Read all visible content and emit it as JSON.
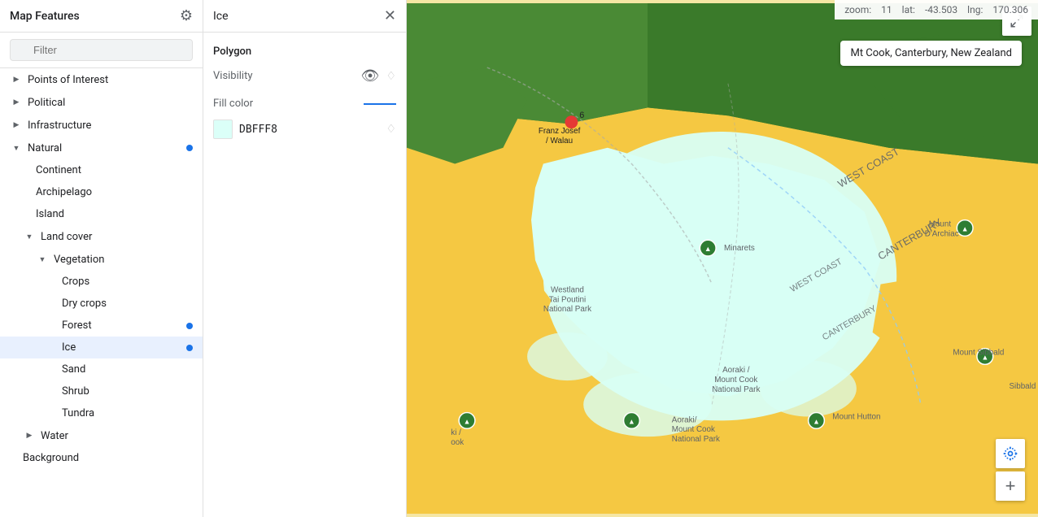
{
  "sidebar": {
    "title": "Map Features",
    "filter_placeholder": "Filter",
    "items": [
      {
        "id": "points-of-interest",
        "label": "Points of Interest",
        "indent": 0,
        "hasChevron": true,
        "chevronDir": "right",
        "dot": false,
        "active": false
      },
      {
        "id": "political",
        "label": "Political",
        "indent": 0,
        "hasChevron": true,
        "chevronDir": "right",
        "dot": false,
        "active": false
      },
      {
        "id": "infrastructure",
        "label": "Infrastructure",
        "indent": 0,
        "hasChevron": true,
        "chevronDir": "right",
        "dot": false,
        "active": false
      },
      {
        "id": "natural",
        "label": "Natural",
        "indent": 0,
        "hasChevron": true,
        "chevronDir": "down",
        "dot": true,
        "active": false
      },
      {
        "id": "continent",
        "label": "Continent",
        "indent": 1,
        "hasChevron": false,
        "dot": false,
        "active": false
      },
      {
        "id": "archipelago",
        "label": "Archipelago",
        "indent": 1,
        "hasChevron": false,
        "dot": false,
        "active": false
      },
      {
        "id": "island",
        "label": "Island",
        "indent": 1,
        "hasChevron": false,
        "dot": false,
        "active": false
      },
      {
        "id": "land-cover",
        "label": "Land cover",
        "indent": 1,
        "hasChevron": true,
        "chevronDir": "down",
        "dot": false,
        "active": false
      },
      {
        "id": "vegetation",
        "label": "Vegetation",
        "indent": 2,
        "hasChevron": true,
        "chevronDir": "down",
        "dot": false,
        "active": false
      },
      {
        "id": "crops",
        "label": "Crops",
        "indent": 3,
        "hasChevron": false,
        "dot": false,
        "active": false
      },
      {
        "id": "dry-crops",
        "label": "Dry crops",
        "indent": 3,
        "hasChevron": false,
        "dot": false,
        "active": false
      },
      {
        "id": "forest",
        "label": "Forest",
        "indent": 3,
        "hasChevron": false,
        "dot": true,
        "active": false
      },
      {
        "id": "ice",
        "label": "Ice",
        "indent": 3,
        "hasChevron": false,
        "dot": true,
        "active": true
      },
      {
        "id": "sand",
        "label": "Sand",
        "indent": 3,
        "hasChevron": false,
        "dot": false,
        "active": false
      },
      {
        "id": "shrub",
        "label": "Shrub",
        "indent": 3,
        "hasChevron": false,
        "dot": false,
        "active": false
      },
      {
        "id": "tundra",
        "label": "Tundra",
        "indent": 3,
        "hasChevron": false,
        "dot": false,
        "active": false
      },
      {
        "id": "water",
        "label": "Water",
        "indent": 1,
        "hasChevron": true,
        "chevronDir": "right",
        "dot": false,
        "active": false
      },
      {
        "id": "background",
        "label": "Background",
        "indent": 0,
        "hasChevron": false,
        "dot": false,
        "active": false
      }
    ]
  },
  "detail": {
    "title": "Ice",
    "section": "Polygon",
    "visibility_label": "Visibility",
    "fill_color_label": "Fill color",
    "color_hex": "DBFFF8",
    "color_bg": "#DBFFF8"
  },
  "map": {
    "zoom_label": "zoom:",
    "zoom_value": "11",
    "lat_label": "lat:",
    "lat_value": "-43.503",
    "lng_label": "lng:",
    "lng_value": "170.306",
    "location_badge": "Mt Cook, Canterbury, New Zealand"
  }
}
